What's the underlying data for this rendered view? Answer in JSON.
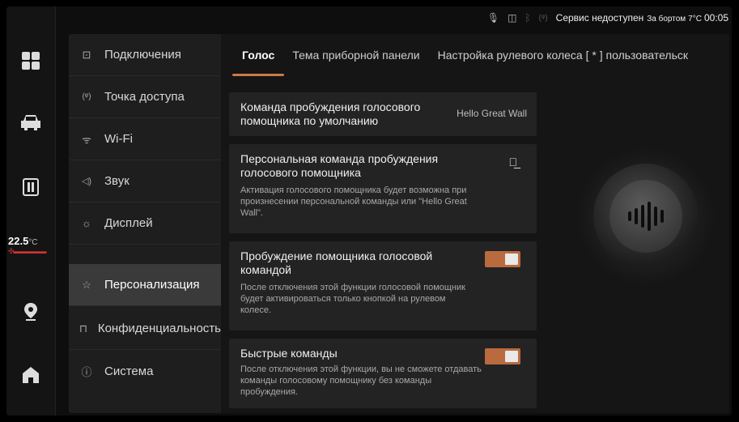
{
  "status_bar": {
    "mic_icon": "microphone-icon",
    "vibrate_icon": "vibrate-icon",
    "bluetooth_icon": "bluetooth-icon",
    "hotspot_icon": "hotspot-icon",
    "service_text": "Сервис недоступен",
    "outside_label": "За бортом",
    "outside_temp": "7°C",
    "time": "00:05"
  },
  "dock": {
    "items": [
      {
        "name": "apps",
        "icon": "apps-grid-icon"
      },
      {
        "name": "car",
        "icon": "car-icon"
      },
      {
        "name": "vehicle-settings",
        "icon": "seat-icon"
      },
      {
        "name": "navigation",
        "icon": "location-pin-icon"
      },
      {
        "name": "home",
        "icon": "home-icon"
      }
    ],
    "temperature": "22.5",
    "temperature_unit": "°C",
    "fan": "fan-icon"
  },
  "nav": {
    "items": [
      {
        "label": "Подключения",
        "icon": "connection-icon",
        "glyph": "⊡"
      },
      {
        "label": "Точка доступа",
        "icon": "hotspot-icon",
        "glyph": "(ᵠ)"
      },
      {
        "label": "Wi-Fi",
        "icon": "wifi-icon",
        "glyph": "ᯤ"
      },
      {
        "label": "Звук",
        "icon": "speaker-icon",
        "glyph": "◁)"
      },
      {
        "label": "Дисплей",
        "icon": "brightness-icon",
        "glyph": "☼"
      },
      {
        "label": "Персонализация",
        "icon": "personalization-icon",
        "glyph": "☆"
      },
      {
        "label": "Конфиденциальность",
        "icon": "lock-icon",
        "glyph": "⊓"
      },
      {
        "label": "Система",
        "icon": "system-info-icon",
        "glyph": "ⓘ"
      }
    ],
    "active_index": 5
  },
  "tabs": [
    {
      "label": "Голос",
      "active": true
    },
    {
      "label": "Тема приборной панели",
      "active": false
    },
    {
      "label": "Настройка рулевого колеса [ * ] пользовательск",
      "active": false
    }
  ],
  "cards": {
    "wake_default": {
      "title": "Команда пробуждения голосового помощника по умолчанию",
      "value": "Hello Great Wall"
    },
    "wake_custom": {
      "title": "Персональная команда пробуждения голосового помощника",
      "desc": "Активация голосового помощника будет возможна при произнесении персональной команды или \"Hello Great Wall\".",
      "edit_icon": "edit-pencil-icon"
    },
    "voice_wake": {
      "title": "Пробуждение помощника голосовой командой",
      "desc": "После отключения этой функции голосовой помощник будет активироваться только кнопкой на рулевом колесе.",
      "toggle_on": true
    },
    "quick_commands": {
      "title": "Быстрые команды",
      "desc": "После отключения этой функции, вы не сможете отдавать команды голосовому помощнику без команды пробуждения.",
      "toggle_on": true
    }
  },
  "colors": {
    "accent": "#c97a47",
    "toggle_on": "#b96a3e",
    "background": "#0e0e0e",
    "nav_active": "#3a3a3a"
  },
  "assistant_visual": "voice-assistant-orb-icon"
}
